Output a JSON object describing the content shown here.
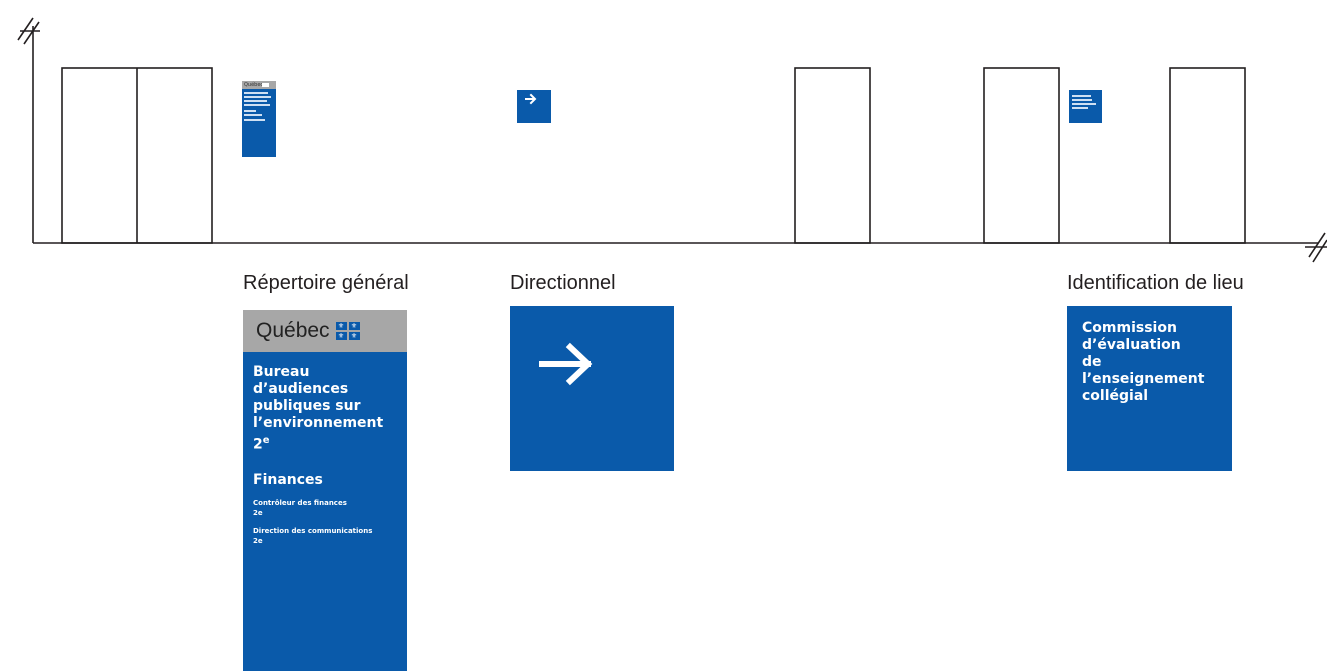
{
  "labels": {
    "directory": "Répertoire général",
    "directional": "Directionnel",
    "place": "Identification de lieu"
  },
  "directory_sign": {
    "brand": "Québec",
    "flag_symbol": "⚜",
    "organization": "Bureau\nd’audiences\npubliques sur\nl’environnement",
    "organization_floor": "2",
    "organization_floor_suffix": "e",
    "section": "Finances",
    "entries": [
      {
        "name": "Contrôleur des finances",
        "floor": "2e"
      },
      {
        "name": "Direction des communications",
        "floor": "2e"
      }
    ]
  },
  "directional_sign": {
    "arrow": "arrow-right-icon"
  },
  "place_sign": {
    "text": "Commission\nd’évaluation\nde l’enseignement\ncollégial"
  },
  "mini_signs": {
    "directory_brand": "Québec",
    "arrow_glyph": "→"
  },
  "colors": {
    "sign_blue": "#0a5aaa",
    "header_gray": "#a7a7a7",
    "line": "#231f20"
  }
}
